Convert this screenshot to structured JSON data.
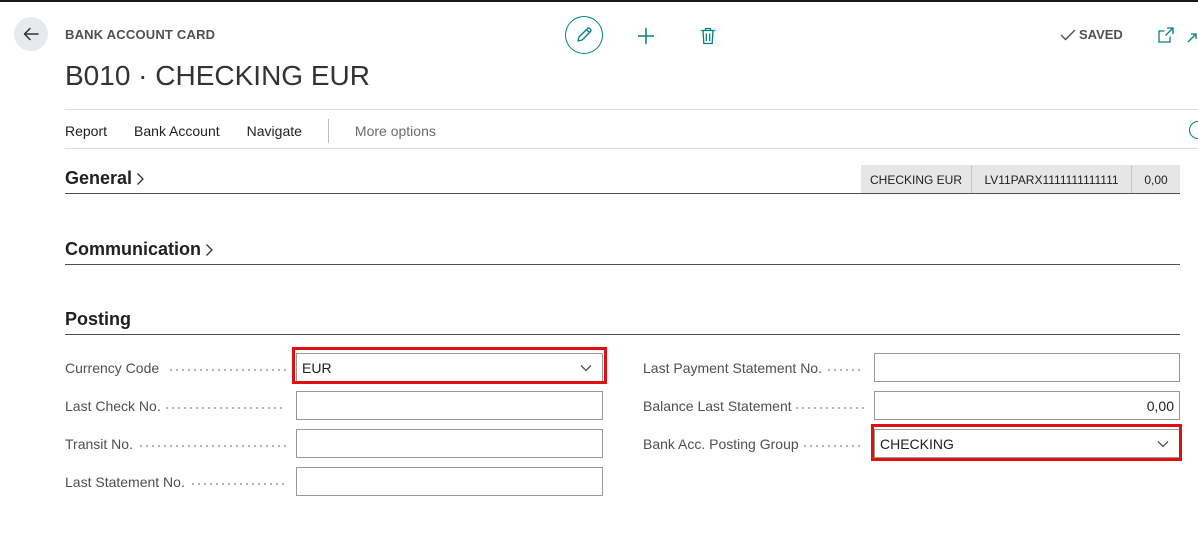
{
  "header": {
    "breadcrumb": "BANK ACCOUNT CARD",
    "title": "B010 · CHECKING EUR",
    "saved_label": "SAVED"
  },
  "actions": {
    "report": "Report",
    "bank_account": "Bank Account",
    "navigate": "Navigate",
    "more_options": "More options"
  },
  "sections": {
    "general": "General",
    "communication": "Communication",
    "posting": "Posting"
  },
  "factbox": {
    "name": "CHECKING EUR",
    "iban": "LV11PARX1111111111111",
    "balance": "0,00"
  },
  "posting": {
    "currency_code": {
      "label": "Currency Code",
      "value": "EUR"
    },
    "last_check_no": {
      "label": "Last Check No.",
      "value": ""
    },
    "transit_no": {
      "label": "Transit No.",
      "value": ""
    },
    "last_statement_no": {
      "label": "Last Statement No.",
      "value": ""
    },
    "last_payment_statement_no": {
      "label": "Last Payment Statement No.",
      "value": ""
    },
    "balance_last_statement": {
      "label": "Balance Last Statement",
      "value": "0,00"
    },
    "bank_acc_posting_group": {
      "label": "Bank Acc. Posting Group",
      "value": "CHECKING"
    }
  },
  "colors": {
    "accent": "#00827f",
    "highlight": "#e01010",
    "factbox_bg": "#e6e6e6"
  },
  "icons": [
    "back-arrow-icon",
    "pencil-icon",
    "plus-icon",
    "trash-icon",
    "checkmark-icon",
    "popout-icon",
    "expand-icon",
    "chevron-right-icon",
    "chevron-down-icon",
    "search-icon"
  ]
}
